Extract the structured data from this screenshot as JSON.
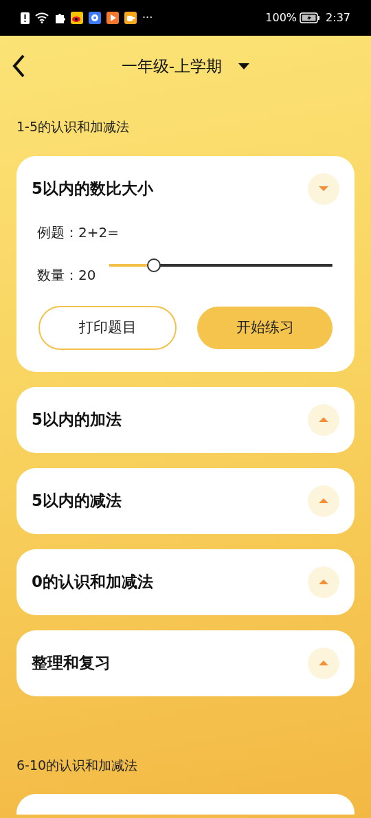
{
  "status_bar": {
    "battery": "100%",
    "time": "2:37",
    "more": "···"
  },
  "header": {
    "title": "一年级-上学期"
  },
  "sections": [
    {
      "title": "1-5的认识和加减法",
      "more_below": false,
      "lessons": [
        {
          "title": "5以内的数比大小",
          "expanded": true,
          "example_label": "例题：",
          "example": "2+2=",
          "count_label": "数量：",
          "count": "20",
          "level": 0.2,
          "buttons": [
            "打印题目",
            "开始练习"
          ]
        },
        {
          "title": "5以内的加法",
          "expanded": false
        },
        {
          "title": "5以内的减法",
          "expanded": false
        },
        {
          "title": "0的认识和加减法",
          "expanded": false
        },
        {
          "title": "整理和复习",
          "expanded": false
        }
      ]
    },
    {
      "title": "6-10的认识和加减法",
      "more_below": true
    }
  ]
}
